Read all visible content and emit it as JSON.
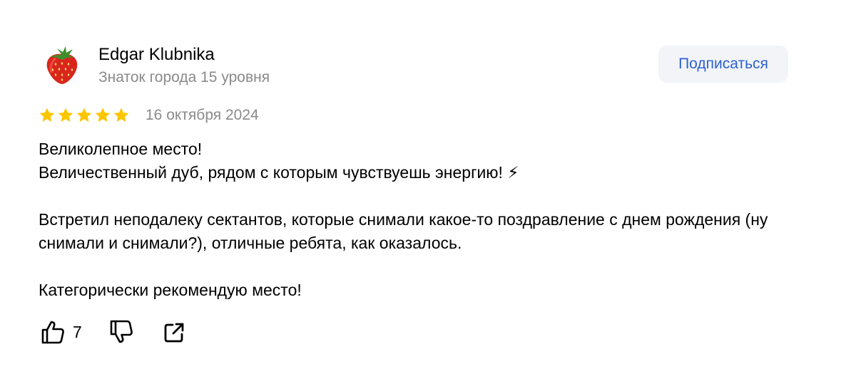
{
  "author": {
    "name": "Edgar Klubnika",
    "status": "Знаток города 15 уровня",
    "avatar_icon": "strawberry-icon"
  },
  "subscribe_label": "Подписаться",
  "review": {
    "rating": 5,
    "rating_max": 5,
    "date": "16 октября 2024",
    "paragraphs": [
      "Великолепное место!",
      "Величественный дуб, рядом с которым чувствуешь энергию! ⚡",
      "",
      "Встретил неподалеку сектантов, которые снимали какое-то поздравление с днем рождения (ну снимали и снимали?), отличные ребята, как оказалось.",
      "",
      "Категорически рекомендую место!"
    ]
  },
  "actions": {
    "likes": "7",
    "like_icon": "thumbs-up-icon",
    "dislike_icon": "thumbs-down-icon",
    "share_icon": "share-icon"
  },
  "colors": {
    "star": "#fcc600",
    "link": "#2c61d3",
    "button_bg": "#f2f4f7",
    "secondary_text": "#8a8a8a"
  }
}
